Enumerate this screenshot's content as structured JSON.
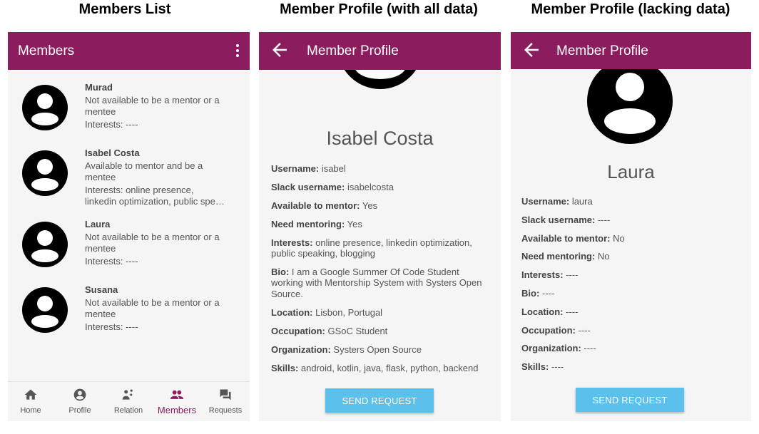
{
  "captions": {
    "members_list": "Members List",
    "profile_full": "Member Profile (with all data)",
    "profile_lacking": "Member Profile (lacking data)"
  },
  "colors": {
    "appbar": "#8b1d5e",
    "button": "#5bc0eb",
    "active_nav": "#8b1d5e"
  },
  "members_screen": {
    "title": "Members",
    "menu_icon": "more-vert-icon",
    "members": [
      {
        "name": "Murad",
        "line1": "Not available to be a mentor or a",
        "line2": "mentee",
        "line3": "Interests: ----",
        "line4": ""
      },
      {
        "name": "Isabel Costa",
        "line1": "Available to mentor and be a",
        "line2": "mentee",
        "line3": "Interests: online presence,",
        "line4": "linkedin optimization, public spe…"
      },
      {
        "name": "Laura",
        "line1": "Not available to be a mentor or a",
        "line2": "mentee",
        "line3": "Interests: ----",
        "line4": ""
      },
      {
        "name": "Susana",
        "line1": "Not available to be a mentor or a",
        "line2": "mentee",
        "line3": "Interests: ----",
        "line4": ""
      }
    ],
    "nav": [
      {
        "label": "Home",
        "icon": "home-icon"
      },
      {
        "label": "Profile",
        "icon": "account-circle-icon"
      },
      {
        "label": "Relation",
        "icon": "relation-icon"
      },
      {
        "label": "Members",
        "icon": "people-icon"
      },
      {
        "label": "Requests",
        "icon": "forum-icon"
      }
    ]
  },
  "profile_full": {
    "title": "Member Profile",
    "name": "Isabel Costa",
    "fields": [
      {
        "label": "Username:",
        "value": " isabel"
      },
      {
        "label": "Slack username:",
        "value": " isabelcosta"
      },
      {
        "label": "Available to mentor:",
        "value": " Yes"
      },
      {
        "label": "Need mentoring:",
        "value": " Yes"
      },
      {
        "label": "Interests:",
        "value": " online presence, linkedin optimization,",
        "value2": "public speaking, blogging"
      },
      {
        "label": "Bio:",
        "value": " I am a Google Summer Of Code Student",
        "value2": "working with Mentorship System with Systers Open",
        "value3": "Source."
      },
      {
        "label": "Location:",
        "value": " Lisbon, Portugal"
      },
      {
        "label": "Occupation:",
        "value": " GSoC Student"
      },
      {
        "label": "Organization:",
        "value": " Systers Open Source"
      },
      {
        "label": "Skills:",
        "value": " android, kotlin, java, flask, python, backend"
      }
    ],
    "button": "SEND REQUEST"
  },
  "profile_lacking": {
    "title": "Member Profile",
    "name": "Laura",
    "fields": [
      {
        "label": "Username:",
        "value": " laura"
      },
      {
        "label": "Slack username:",
        "value": " ----"
      },
      {
        "label": "Available to mentor:",
        "value": " No"
      },
      {
        "label": "Need mentoring:",
        "value": " No"
      },
      {
        "label": "Interests:",
        "value": " ----"
      },
      {
        "label": "Bio:",
        "value": " ----"
      },
      {
        "label": "Location:",
        "value": " ----"
      },
      {
        "label": "Occupation:",
        "value": " ----"
      },
      {
        "label": "Organization:",
        "value": " ----"
      },
      {
        "label": "Skills:",
        "value": " ----"
      }
    ],
    "button": "SEND REQUEST"
  }
}
